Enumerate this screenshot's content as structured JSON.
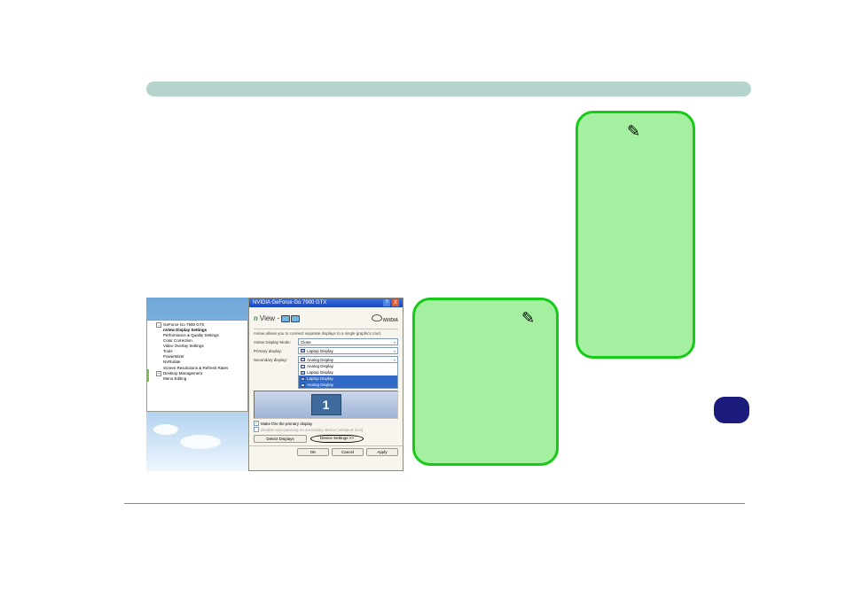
{
  "dialog": {
    "title": "NVIDIA GeForce Go 7900 GTX",
    "help_label": "?",
    "close_label": "X",
    "brand_n": "n",
    "brand_view": "View",
    "brand_tm": "™",
    "nvidia_brand": "NVIDIA",
    "description": "nView allows you to connect separate displays to a single graphics card.",
    "mode_label": "nView Display Mode:",
    "mode_value": "Clone",
    "primary_label": "Primary display:",
    "primary_value": "Laptop Display",
    "secondary_label": "Secondary display:",
    "secondary_value": "Analog Display",
    "dropdown_options": [
      {
        "label": "Analog Display",
        "icon": "mon",
        "hl": false
      },
      {
        "label": "Laptop Display",
        "icon": "lap",
        "hl": false
      },
      {
        "label": "Laptop Display",
        "icon": "lap",
        "hl": true
      },
      {
        "label": "Analog Display",
        "icon": "mon",
        "hl": true
      }
    ],
    "monitor_number": "1",
    "chk_primary_checked": "✓",
    "chk_primary_label": "Make this the primary display",
    "chk_autopan_label": "Disable auto-panning on secondary device (viewport lock)",
    "btn_detect": "Detect Displays",
    "btn_device": "Device Settings >>",
    "btn_ok": "OK",
    "btn_cancel": "Cancel",
    "btn_apply": "Apply"
  },
  "tree": {
    "root": "GeForce Go 7900 GTX",
    "items": [
      "nView Display Settings",
      "Performance & Quality Settings",
      "Color Correction",
      "Video Overlay Settings",
      "Tools",
      "PowerMizer",
      "NVRotate",
      "Screen Resolutions & Refresh Rates"
    ],
    "root2": "Desktop Management",
    "item2": "Menu Editing",
    "expand": "-",
    "expand2": "+"
  }
}
